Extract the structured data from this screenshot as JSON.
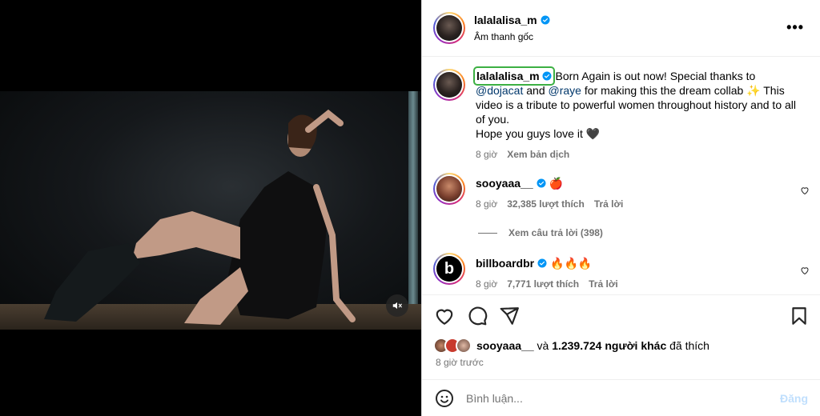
{
  "post": {
    "author": "lalalalisa_m",
    "audio": "Âm thanh gốc",
    "more_icon": "more-horizontal-icon"
  },
  "caption": {
    "author": "lalalalisa_m",
    "text_1": " Born Again is out now! Special thanks to ",
    "mention_1": "@dojacat",
    "text_2": " and ",
    "mention_2": "@raye",
    "text_3": " for making this the dream collab ",
    "sparkle": "✨",
    "text_4": " This video is a tribute to powerful women throughout history and to all of you.",
    "line_2": "Hope you guys love it 🖤",
    "time": "8 giờ",
    "translate": "Xem bản dịch"
  },
  "comments": [
    {
      "author": "sooyaaa__",
      "text": "🍎",
      "time": "8 giờ",
      "likes": "32,385 lượt thích",
      "reply": "Trả lời"
    },
    {
      "author": "billboardbr",
      "text": "🔥🔥🔥",
      "time": "8 giờ",
      "likes": "7,771 lượt thích",
      "reply": "Trả lời"
    }
  ],
  "view_replies": "Xem câu trả lời (398)",
  "likes": {
    "first_user": "sooyaaa__",
    "connector": " và ",
    "others": "1.239.724 người khác",
    "suffix": " đã thích"
  },
  "time_ago": "8 giờ trước",
  "comment_input": {
    "placeholder": "Bình luận...",
    "post_label": "Đăng"
  },
  "colors": {
    "verified": "#0095f6",
    "link": "#00376b",
    "secondary": "#737373",
    "post_disabled": "#c0dffd",
    "highlight": "#3cb043"
  }
}
